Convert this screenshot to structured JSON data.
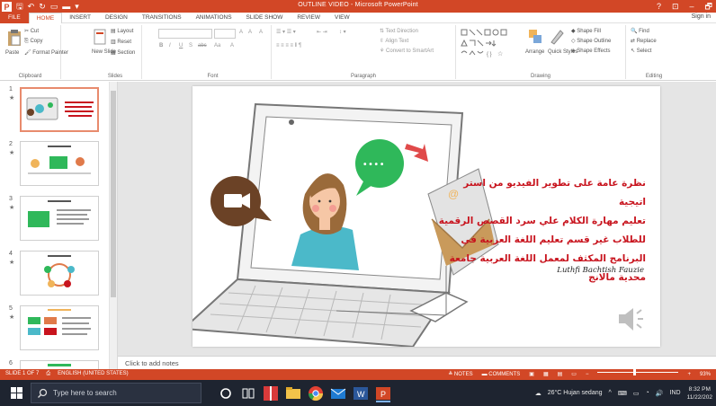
{
  "window": {
    "title": "OUTLINE VIDEO - Microsoft PowerPoint",
    "controls": [
      "?",
      "⊡",
      "–",
      "🗗"
    ]
  },
  "tabs": [
    "FILE",
    "HOME",
    "INSERT",
    "DESIGN",
    "TRANSITIONS",
    "ANIMATIONS",
    "SLIDE SHOW",
    "REVIEW",
    "VIEW"
  ],
  "signin": "Sign in",
  "ribbon": {
    "clipboard": {
      "paste": "Paste",
      "cut": "Cut",
      "copy": "Copy",
      "format_painter": "Format Painter",
      "label": "Clipboard"
    },
    "slides": {
      "new_slide": "New Slide",
      "layout": "Layout",
      "reset": "Reset",
      "section": "Section",
      "label": "Slides"
    },
    "font": {
      "bold": "B",
      "italic": "I",
      "underline": "U",
      "strike": "S",
      "spacing": "abc",
      "case": "Aa",
      "grow": "A",
      "shrink": "A",
      "clear": "A",
      "label": "Font"
    },
    "paragraph": {
      "text_direction": "Text Direction",
      "align_text": "Align Text",
      "smartart": "Convert to SmartArt",
      "label": "Paragraph"
    },
    "drawing": {
      "arrange": "Arrange",
      "quick_styles": "Quick Styles",
      "shape_fill": "Shape Fill",
      "shape_outline": "Shape Outline",
      "shape_effects": "Shape Effects",
      "label": "Drawing"
    },
    "editing": {
      "find": "Find",
      "replace": "Replace",
      "select": "Select",
      "label": "Editing"
    }
  },
  "thumbnails": [
    {
      "num": "1",
      "star": "★",
      "selected": true
    },
    {
      "num": "2",
      "star": "★",
      "selected": false
    },
    {
      "num": "3",
      "star": "★",
      "selected": false
    },
    {
      "num": "4",
      "star": "★",
      "selected": false
    },
    {
      "num": "5",
      "star": "★",
      "selected": false
    },
    {
      "num": "6",
      "star": "★",
      "selected": false
    }
  ],
  "slide": {
    "arabic_lines": [
      "نظرة عامة على تطوير الفيديو من استر اتيجية",
      "تعليم مهارة الكلام علي سرد القصص الرقمية",
      "للطلاب غير قسم تعليم اللغة العربية  في",
      "البرنامج المكثف لمعمل اللغة العربية جامعة",
      "محدية مالانج"
    ],
    "author": "Luthfi Bachtish Fauzie",
    "chat_dots": "• • • •",
    "email_symbol": "@"
  },
  "notes_placeholder": "Click to add notes",
  "status": {
    "slide_counter": "SLIDE 1 OF 7",
    "language": "ENGLISH (UNITED STATES)",
    "notes": "NOTES",
    "comments": "COMMENTS",
    "zoom": "93%"
  },
  "taskbar": {
    "search_placeholder": "Type here to search",
    "weather": "26°C  Hujan sedang",
    "lang": "IND",
    "time": "8:32 PM",
    "date": "11/22/202"
  },
  "colors": {
    "accent": "#d24726",
    "slide_text": "#c8141e",
    "brown": "#6b4226",
    "green": "#2fb85a",
    "teal": "#4bb9c9"
  }
}
